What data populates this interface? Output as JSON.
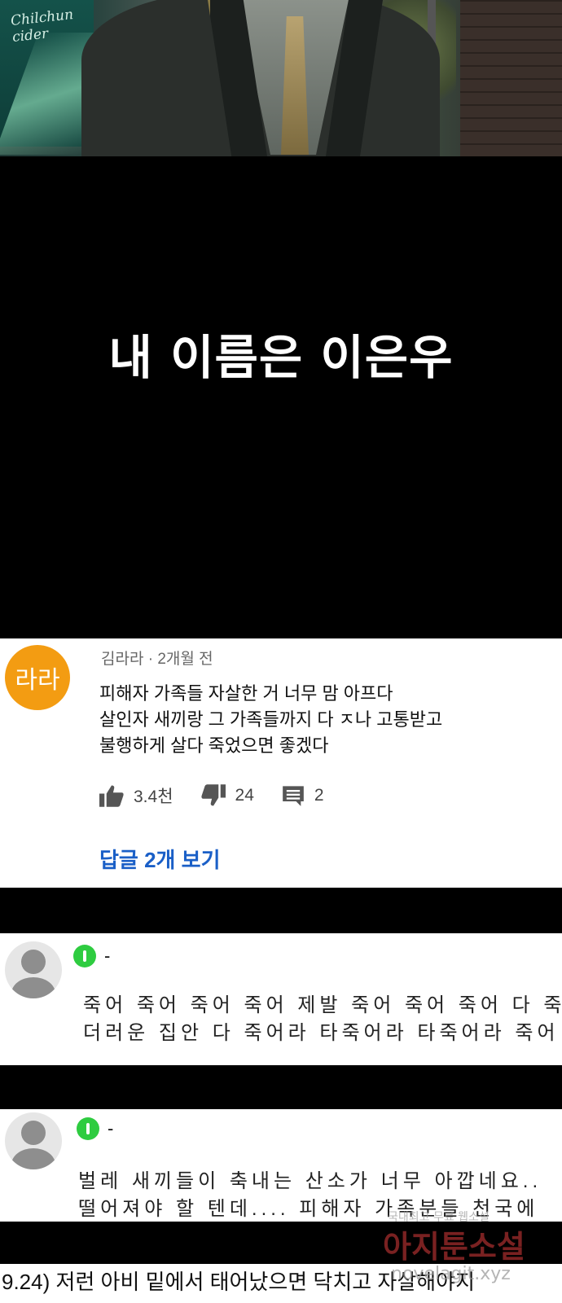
{
  "art": {
    "sign_text": "Chilchun\ncider"
  },
  "caption": "내 이름은 이은우",
  "comment1": {
    "avatar_text": "라라",
    "avatar_color": "#f39c12",
    "meta": "김라라 · 2개월 전",
    "lines": [
      "피해자 가족들 자살한 거 너무 맘 아프다",
      "살인자 새끼랑 그 가족들까지 다 ㅈ나 고통받고",
      "불행하게 살다 죽었으면 좋겠다"
    ],
    "likes": "3.4천",
    "dislikes": "24",
    "reply_count": "2",
    "view_replies": "답글 2개 보기",
    "link_color": "#1a5fc7"
  },
  "comment2": {
    "name": "-",
    "lines": [
      "죽어 죽어 죽어 죽어 제발 죽어 죽어 죽어 다 죽",
      "더러운 집안 다 죽어라 타죽어라 타죽어라 죽어"
    ]
  },
  "comment3": {
    "name": "-",
    "lines": [
      "벌레 새끼들이 축내는 산소가 너무 아깝네요..",
      "떨어져야 할 텐데.... 피해자 가족분들 천국에"
    ]
  },
  "bottom_text": "9.24)   저런 아비 밑에서 태어났으면 닥치고 자살해야지",
  "watermark": {
    "line1": "국내최고 무료 웹소설",
    "line2": "아지툰소설",
    "line3": "novelagit.xyz"
  },
  "badge_color": "#2ecc40"
}
